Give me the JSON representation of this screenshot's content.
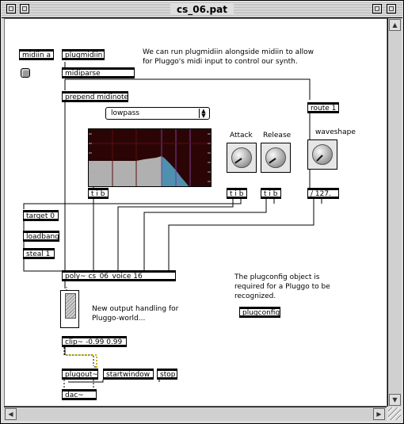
{
  "window": {
    "title": "cs_06.pat"
  },
  "objects": {
    "midiin": "midiin a",
    "plugmidiin": "plugmidiin",
    "midiparse": "midiparse",
    "prepend": "prepend midinote",
    "route": "route 1",
    "tib1": "t i b",
    "tib2": "t i b",
    "tib3": "t i b",
    "div127": "/ 127.",
    "target": "target 0",
    "loadbang": "loadbang",
    "steal": "steal 1",
    "poly": "poly~ cs_06_voice 16",
    "plugconfig": "plugconfig",
    "clip": "clip~ -0.99 0.99",
    "plugout": "plugout~",
    "startwindow": "startwindow",
    "stop": "stop",
    "dac": "dac~"
  },
  "menu": {
    "filter_type": "lowpass"
  },
  "labels": {
    "attack": "Attack",
    "release": "Release",
    "waveshape": "waveshape"
  },
  "comments": {
    "top": "We can run plugmidiin alongside midiin to allow\nfor Pluggo's midi input to control our synth.",
    "plugconfig": "The plugconfig object is\nrequired for a Pluggo to be\nrecognized.",
    "output": "New output handling for\nPluggo-world..."
  },
  "colors": {
    "filter_bg": "#2b0505",
    "filter_curve": "#4f8fb0",
    "filter_passband": "#b0b0b0",
    "filter_grid": "#7b3a96"
  },
  "icons": [
    "close-box-icon",
    "zoom-box-icon",
    "collapse-box-icon",
    "scroll-up-icon",
    "scroll-down-icon",
    "scroll-left-icon",
    "scroll-right-icon",
    "resize-grip-icon"
  ]
}
